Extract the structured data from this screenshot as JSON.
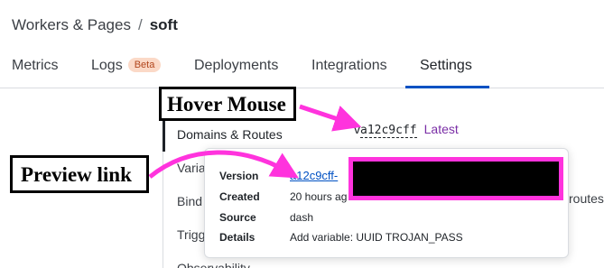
{
  "breadcrumb": {
    "parent": "Workers & Pages",
    "separator": "/",
    "current": "soft"
  },
  "tabs": [
    {
      "label": "Metrics"
    },
    {
      "label": "Logs",
      "badge": "Beta"
    },
    {
      "label": "Deployments"
    },
    {
      "label": "Integrations"
    },
    {
      "label": "Settings",
      "active": true
    }
  ],
  "settings_nav": [
    {
      "label": "Domains & Routes",
      "active": true
    },
    {
      "label": "Varia"
    },
    {
      "label": "Bind"
    },
    {
      "label": "Trigg"
    },
    {
      "label": "Observability"
    }
  ],
  "version_line": {
    "prefix": "v",
    "version": "a12c9cff",
    "status": "Latest"
  },
  "routes_peek": "routes",
  "popover": {
    "version_label": "Version",
    "version_value": "a12c9cff-",
    "created_label": "Created",
    "created_value": "20 hours ag",
    "source_label": "Source",
    "source_value": "dash",
    "details_label": "Details",
    "details_value": "Add variable: UUID TROJAN_PASS",
    "external_icon": "external-link-icon"
  },
  "annotations": {
    "hover_label": "Hover Mouse",
    "preview_label": "Preview link",
    "highlight_color": "#ff33dd",
    "redaction_color": "#000000"
  },
  "colors": {
    "accent": "#0051c3",
    "latest": "#7a2ea6",
    "beta_bg": "#fbd9c7",
    "beta_text": "#b2461d"
  }
}
